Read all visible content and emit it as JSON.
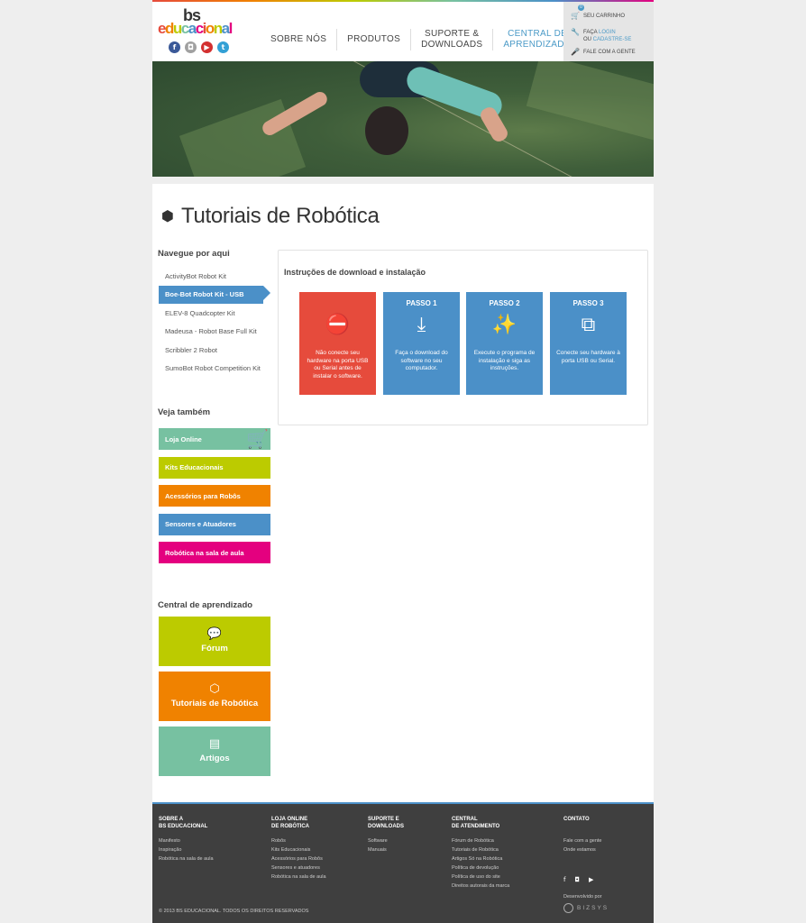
{
  "header": {
    "logo_top": "bs",
    "logo_bottom": [
      "e",
      "d",
      "u",
      "c",
      "a",
      "c",
      "i",
      "o",
      "n",
      "a",
      "l"
    ],
    "logo_colors": [
      "#e64b3c",
      "#f08200",
      "#bccb00",
      "#77c1a1",
      "#4b90c8",
      "#e4007f",
      "#e64b3c",
      "#f08200",
      "#bccb00",
      "#4b90c8",
      "#e4007f"
    ],
    "social": [
      {
        "icon": "facebook-icon",
        "glyph": "f",
        "color": "#3b5998"
      },
      {
        "icon": "instagram-icon",
        "glyph": "◘",
        "color": "#a0a0a0"
      },
      {
        "icon": "youtube-icon",
        "glyph": "▶",
        "color": "#d32f2f"
      },
      {
        "icon": "twitter-icon",
        "glyph": "t",
        "color": "#33a0d5"
      }
    ],
    "nav": [
      "SOBRE NÓS",
      "PRODUTOS",
      "SUPORTE &\nDOWNLOADS",
      "CENTRAL DE\nAPRENDIZADO"
    ],
    "cart_count": "0",
    "cart_label": "SEU CARRINHO",
    "login_prefix": "FAÇA",
    "login_link": "LOGIN",
    "or_text": "OU",
    "signup_link": "CADASTRE-SE",
    "contact_label": "FALE COM A GENTE"
  },
  "page": {
    "title": "Tutoriais de Robótica",
    "nav_heading": "Navegue por aqui",
    "kits": [
      "ActivityBot Robot Kit",
      "Boe-Bot Robot Kit - USB",
      "ELEV-8 Quadcopter Kit",
      "Madeusa - Robot Base Full Kit",
      "Scribbler 2 Robot",
      "SumoBot Robot Competition Kit"
    ],
    "active_kit_index": 1,
    "see_also_heading": "Veja também",
    "see_also": [
      {
        "label": "Loja Online",
        "color": "#77c1a1"
      },
      {
        "label": "Kits Educacionais",
        "color": "#bccb00"
      },
      {
        "label": "Acessórios para Robôs",
        "color": "#f08200"
      },
      {
        "label": "Sensores e Atuadores",
        "color": "#4b90c8"
      },
      {
        "label": "Robótica na sala de aula",
        "color": "#e4007f"
      }
    ],
    "learning_heading": "Central de aprendizado",
    "learning": [
      {
        "label": "Fórum",
        "icon": "chat-bubbles-icon",
        "glyph": "💬",
        "color": "#bccb00"
      },
      {
        "label": "Tutoriais de Robótica",
        "icon": "cubes-icon",
        "glyph": "⬡",
        "color": "#f08200"
      },
      {
        "label": "Artigos",
        "icon": "document-icon",
        "glyph": "▤",
        "color": "#77c1a1"
      }
    ]
  },
  "panel": {
    "heading": "Instruções de download e instalação",
    "steps": [
      {
        "header": "",
        "icon": "usb-warning-icon",
        "glyph": "⛔",
        "text": "Não conecte seu hardware na porta USB ou Serial antes de instalar o software.",
        "color": "#e64b3c"
      },
      {
        "header": "PASSO 1",
        "icon": "download-icon",
        "glyph": "⤓",
        "text": "Faça o download do software no seu computador.",
        "color": "#4b90c8"
      },
      {
        "header": "PASSO 2",
        "icon": "magic-wand-icon",
        "glyph": "✨",
        "text": "Execute o programa de instalação e siga as instruções.",
        "color": "#4b90c8"
      },
      {
        "header": "PASSO 3",
        "icon": "usb-plug-icon",
        "glyph": "⧉",
        "text": "Conecte seu hardware à porta USB ou Serial.",
        "color": "#4b90c8"
      }
    ]
  },
  "footer": {
    "columns": [
      {
        "heading": "SOBRE A\nBS EDUCACIONAL",
        "items": [
          "Manifesto",
          "Inspiração",
          "Robótica na sala de aula"
        ]
      },
      {
        "heading": "LOJA ONLINE\nDE ROBÓTICA",
        "items": [
          "Robôs",
          "Kits Educacionais",
          "Acessórios para Robôs",
          "Sensores e atuadores",
          "Robótica na sala de aula"
        ]
      },
      {
        "heading": "SUPORTE E\nDOWNLOADS",
        "items": [
          "Software",
          "Manuais"
        ]
      },
      {
        "heading": "CENTRAL\nDE ATENDIMENTO",
        "items": [
          "Fórum de Robótica",
          "Tutoriais de Robótica",
          "Artigos Só na Robótica",
          "Política de devolução",
          "Política de uso do site",
          "Direitos autorais da marca"
        ]
      },
      {
        "heading": "CONTATO",
        "items": [
          "Fale com a gente",
          "Onde estamos"
        ]
      }
    ],
    "dev_label": "Desenvolvido por",
    "dev_brand": "BIZSYS",
    "copyright": "© 2013 BS EDUCACIONAL. TODOS OS DIREITOS RESERVADOS"
  }
}
